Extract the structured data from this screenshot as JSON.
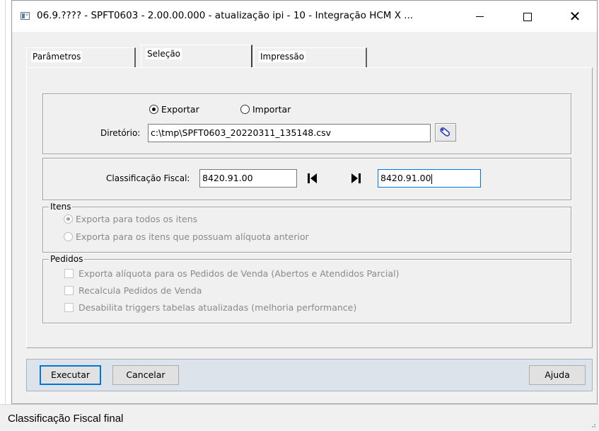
{
  "window": {
    "title": "06.9.???? - SPFT0603 - 2.00.00.000 - atualização ipi - 10 - Integração HCM X ...",
    "minimize_icon": "minimize-icon",
    "maximize_icon": "maximize-icon",
    "close_icon": "close-icon"
  },
  "tabs": [
    {
      "label": "Parâmetros",
      "active": false
    },
    {
      "label": "Seleção",
      "active": true
    },
    {
      "label": "Impressão",
      "active": false
    }
  ],
  "mode": {
    "export_label": "Exportar",
    "import_label": "Importar",
    "selected": "Exportar"
  },
  "directory": {
    "label": "Diretório:",
    "value": "c:\\tmp\\SPFT0603_20220311_135148.csv",
    "browse_icon": "folder-search-icon"
  },
  "classification": {
    "label": "Classificação Fiscal:",
    "start_value": "8420.91.00",
    "end_value": "8420.91.00",
    "first_icon": "first-record-icon",
    "last_icon": "last-record-icon"
  },
  "items_group": {
    "legend": "Itens",
    "options": [
      {
        "label": "Exporta para todos os itens",
        "selected": true
      },
      {
        "label": "Exporta para os itens que possuam alíquota anterior",
        "selected": false
      }
    ]
  },
  "orders_group": {
    "legend": "Pedidos",
    "options": [
      {
        "label": "Exporta alíquota para os Pedidos de Venda (Abertos e Atendidos Parcial)",
        "checked": false
      },
      {
        "label": "Recalcula Pedidos de Venda",
        "checked": false
      },
      {
        "label": "Desabilita triggers tabelas atualizadas (melhoria performance)",
        "checked": false
      }
    ]
  },
  "actions": {
    "execute_label": "Executar",
    "cancel_label": "Cancelar",
    "help_label": "Ajuda"
  },
  "status": {
    "text": "Classificação Fiscal final"
  },
  "colors": {
    "accent": "#0078d7",
    "window_bg": "#f0f0f0",
    "button_bar_bg": "#dde3ea"
  }
}
